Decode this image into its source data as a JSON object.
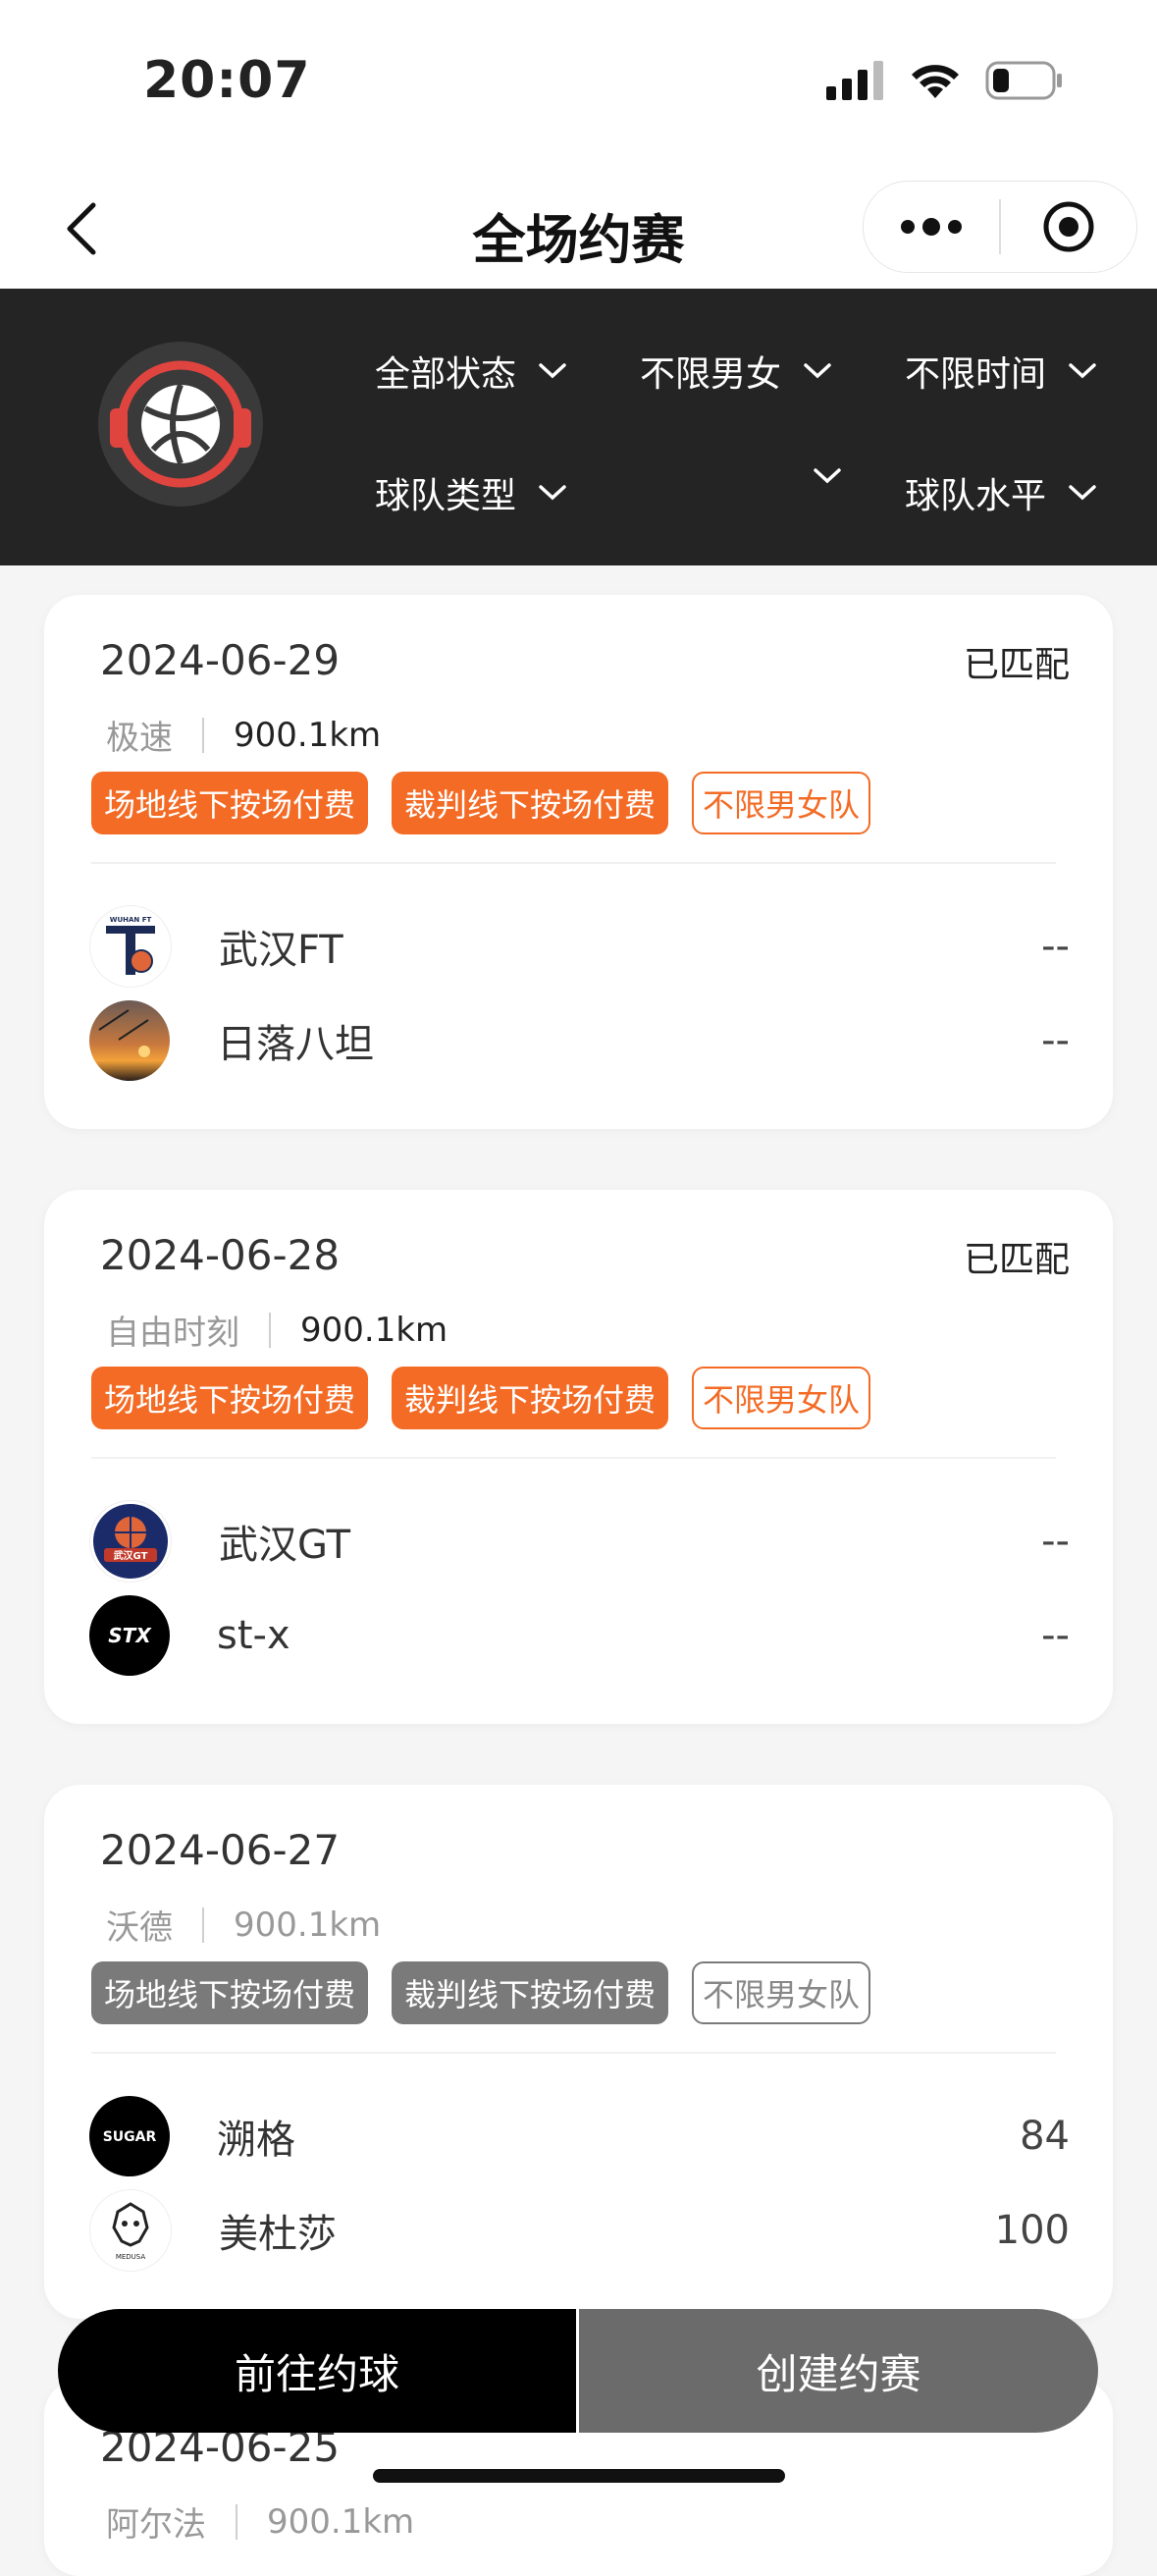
{
  "status_bar": {
    "time": "20:07"
  },
  "nav": {
    "title": "全场约赛",
    "more_label": "•••"
  },
  "filters": {
    "row1": [
      "全部状态",
      "不限男女",
      "不限时间"
    ],
    "row2": [
      "球队类型",
      "",
      "球队水平"
    ]
  },
  "matches": [
    {
      "date": "2024-06-29",
      "status": "已匹配",
      "venue": "极速",
      "distance": "900.1km",
      "tags": [
        "场地线下按场付费",
        "裁判线下按场付费",
        "不限男女队"
      ],
      "teams": [
        {
          "name": "武汉FT",
          "score": "--"
        },
        {
          "name": "日落八坦",
          "score": "--"
        }
      ]
    },
    {
      "date": "2024-06-28",
      "status": "已匹配",
      "venue": "自由时刻",
      "distance": "900.1km",
      "tags": [
        "场地线下按场付费",
        "裁判线下按场付费",
        "不限男女队"
      ],
      "teams": [
        {
          "name": "武汉GT",
          "score": "--"
        },
        {
          "name": "st-x",
          "score": "--"
        }
      ]
    },
    {
      "date": "2024-06-27",
      "status": "",
      "venue": "沃德",
      "distance": "900.1km",
      "tags": [
        "场地线下按场付费",
        "裁判线下按场付费",
        "不限男女队"
      ],
      "teams": [
        {
          "name": "溯格",
          "score": "84"
        },
        {
          "name": "美杜莎",
          "score": "100"
        }
      ]
    },
    {
      "date": "2024-06-25",
      "venue": "阿尔法",
      "distance": "900.1km"
    }
  ],
  "avatar_labels": {
    "stx": "STX",
    "sugar": "SUGAR",
    "ft": "WUHAN FT",
    "gt": "武汉GT",
    "medusa": "MEDUSA"
  },
  "bottom": {
    "left_label": "前往约球",
    "right_label": "创建约赛"
  },
  "colors": {
    "accent": "#f36b25",
    "filter_bg": "#242424",
    "inactive_tag": "#7a7a7a"
  }
}
